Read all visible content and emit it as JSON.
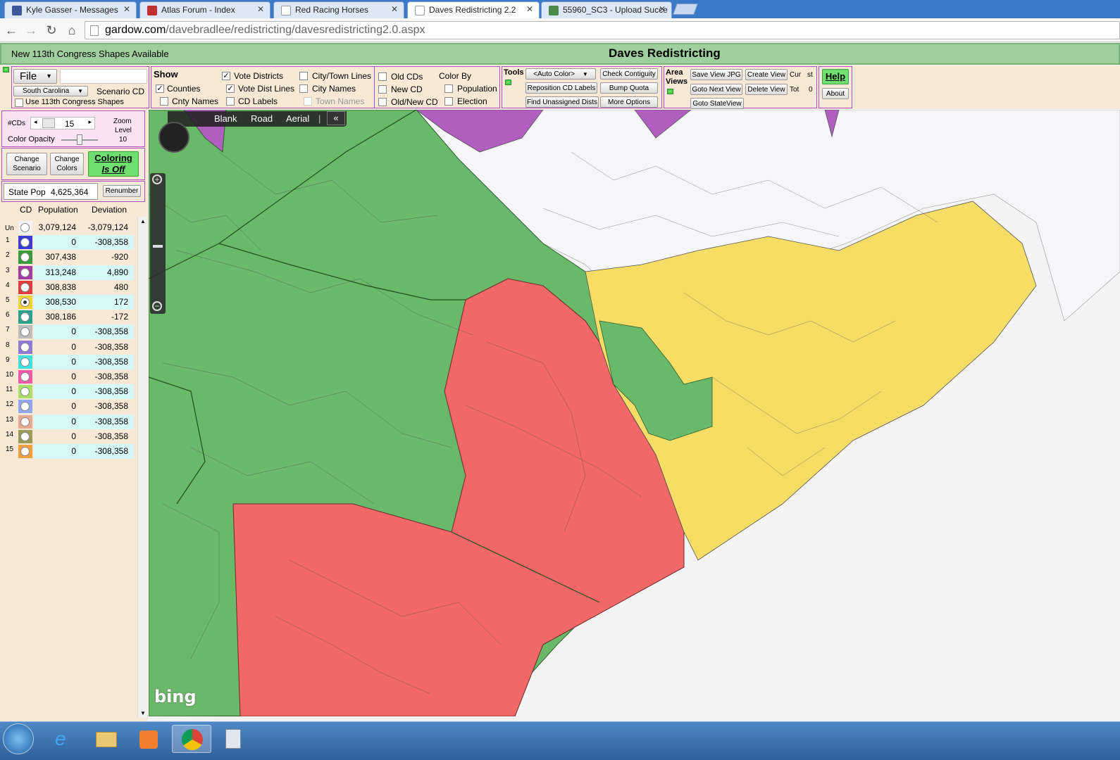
{
  "browser": {
    "tabs": [
      {
        "label": "Kyle Gasser - Messages"
      },
      {
        "label": "Atlas Forum - Index"
      },
      {
        "label": "Red Racing Horses"
      },
      {
        "label": "Daves Redistricting 2.2"
      },
      {
        "label": "55960_SC3 - Upload Succe"
      }
    ],
    "url_host": "gardow.com",
    "url_path": "/davebradlee/redistricting/davesredistricting2.0.aspx"
  },
  "header": {
    "notice": "New 113th Congress Shapes Available",
    "title": "Daves Redistricting"
  },
  "file_group": {
    "file_label": "File",
    "state": "South Carolina",
    "scenario_label": "Scenario CD",
    "use_113": "Use 113th Congress Shapes"
  },
  "show_group": {
    "title": "Show",
    "counties": "Counties",
    "cnty_names": "Cnty Names",
    "vote_districts": "Vote Districts",
    "vote_dist_lines": "Vote Dist Lines",
    "cd_labels": "CD Labels",
    "city_town_lines": "City/Town Lines",
    "city_names": "City Names",
    "town_names": "Town Names",
    "old_cds": "Old CDs",
    "new_cd": "New CD",
    "old_new_cd": "Old/New CD",
    "color_by": "Color By",
    "population": "Population",
    "election": "Election"
  },
  "tools_group": {
    "title": "Tools",
    "auto_color": "<Auto Color>",
    "check_contiguity": "Check Contiguity",
    "reposition_labels": "Reposition CD Labels",
    "bump_quota": "Bump Quota",
    "find_unassigned": "Find Unassigned Dists",
    "more_options": "More Options"
  },
  "views_group": {
    "title_line1": "Area",
    "title_line2": "Views",
    "save_jpg": "Save View JPG",
    "create_view": "Create View",
    "goto_next": "Goto Next View",
    "delete_view": "Delete View",
    "goto_state": "Goto StateView",
    "cur_label": "Cur",
    "cur_value": "st",
    "tot_label": "Tot",
    "tot_value": "0"
  },
  "help_group": {
    "help": "Help",
    "about": "About"
  },
  "left": {
    "cds_label": "#CDs",
    "cds_value": "15",
    "zoom_label_1": "Zoom",
    "zoom_label_2": "Level",
    "zoom_value": "10",
    "color_opacity": "Color Opacity",
    "opacity_value": 0.5,
    "change_scenario_1": "Change",
    "change_scenario_2": "Scenario",
    "change_colors_1": "Change",
    "change_colors_2": "Colors",
    "coloring_1": "Coloring",
    "coloring_2": "Is Off",
    "state_pop_label": "State Pop",
    "state_pop_value": "4,625,364",
    "renumber": "Renumber",
    "col_cd": "CD",
    "col_pop": "Population",
    "col_dev": "Deviation"
  },
  "districts": [
    {
      "cd": "Un",
      "pop": "3,079,124",
      "dev": "-3,079,124",
      "color": "#f2f2f2"
    },
    {
      "cd": "1",
      "pop": "0",
      "dev": "-308,358",
      "color": "#3b3bd6"
    },
    {
      "cd": "2",
      "pop": "307,438",
      "dev": "-920",
      "color": "#3a9b3a"
    },
    {
      "cd": "3",
      "pop": "313,248",
      "dev": "4,890",
      "color": "#a33ca3"
    },
    {
      "cd": "4",
      "pop": "308,838",
      "dev": "480",
      "color": "#e23b3b"
    },
    {
      "cd": "5",
      "pop": "308,530",
      "dev": "172",
      "color": "#f0d23a"
    },
    {
      "cd": "6",
      "pop": "308,186",
      "dev": "-172",
      "color": "#2aa08f"
    },
    {
      "cd": "7",
      "pop": "0",
      "dev": "-308,358",
      "color": "#bdbdbd"
    },
    {
      "cd": "8",
      "pop": "0",
      "dev": "-308,358",
      "color": "#8f7ad6"
    },
    {
      "cd": "9",
      "pop": "0",
      "dev": "-308,358",
      "color": "#3ee0e0"
    },
    {
      "cd": "10",
      "pop": "0",
      "dev": "-308,358",
      "color": "#f05aa8"
    },
    {
      "cd": "11",
      "pop": "0",
      "dev": "-308,358",
      "color": "#a8e06a"
    },
    {
      "cd": "12",
      "pop": "0",
      "dev": "-308,358",
      "color": "#8fa8f0"
    },
    {
      "cd": "13",
      "pop": "0",
      "dev": "-308,358",
      "color": "#e8a88f"
    },
    {
      "cd": "14",
      "pop": "0",
      "dev": "-308,358",
      "color": "#9a9a5a"
    },
    {
      "cd": "15",
      "pop": "0",
      "dev": "-308,358",
      "color": "#f0a040"
    }
  ],
  "map": {
    "mode_blank": "Blank",
    "mode_road": "Road",
    "mode_aerial": "Aerial",
    "brand": "bing"
  }
}
